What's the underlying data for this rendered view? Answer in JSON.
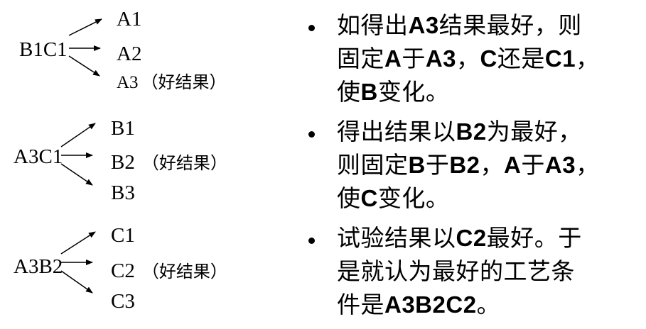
{
  "left": {
    "groups": [
      {
        "source": "B1C1",
        "targets": [
          {
            "label": "A1",
            "note": ""
          },
          {
            "label": "A2",
            "note": ""
          },
          {
            "label": "A3",
            "note": "（好结果）"
          }
        ]
      },
      {
        "source": "A3C1",
        "targets": [
          {
            "label": "B1",
            "note": ""
          },
          {
            "label": "B2",
            "note": "（好结果）"
          },
          {
            "label": "B3",
            "note": ""
          }
        ]
      },
      {
        "source": "A3B2",
        "targets": [
          {
            "label": "C1",
            "note": ""
          },
          {
            "label": "C2",
            "note": "（好结果）"
          },
          {
            "label": "C3",
            "note": ""
          }
        ]
      }
    ]
  },
  "right": {
    "bullets": [
      {
        "lines": [
          [
            {
              "t": "如得出",
              "b": false
            },
            {
              "t": "A3",
              "b": true
            },
            {
              "t": "结果最好，则",
              "b": false
            }
          ],
          [
            {
              "t": "固定",
              "b": false
            },
            {
              "t": "A",
              "b": true
            },
            {
              "t": "于",
              "b": false
            },
            {
              "t": "A3",
              "b": true
            },
            {
              "t": "，",
              "b": false
            },
            {
              "t": "C",
              "b": true
            },
            {
              "t": "还是",
              "b": false
            },
            {
              "t": "C1",
              "b": true
            },
            {
              "t": "，",
              "b": false
            }
          ],
          [
            {
              "t": "使",
              "b": false
            },
            {
              "t": "B",
              "b": true
            },
            {
              "t": "变化。",
              "b": false
            }
          ]
        ]
      },
      {
        "lines": [
          [
            {
              "t": "得出结果以",
              "b": false
            },
            {
              "t": "B2",
              "b": true
            },
            {
              "t": "为最好，",
              "b": false
            }
          ],
          [
            {
              "t": "则固定",
              "b": false
            },
            {
              "t": "B",
              "b": true
            },
            {
              "t": "于",
              "b": false
            },
            {
              "t": "B2",
              "b": true
            },
            {
              "t": "，",
              "b": false
            },
            {
              "t": "A",
              "b": true
            },
            {
              "t": "于",
              "b": false
            },
            {
              "t": "A3",
              "b": true
            },
            {
              "t": "，",
              "b": false
            }
          ],
          [
            {
              "t": "使",
              "b": false
            },
            {
              "t": "C",
              "b": true
            },
            {
              "t": "变化。",
              "b": false
            }
          ]
        ]
      },
      {
        "lines": [
          [
            {
              "t": "试验结果以",
              "b": false
            },
            {
              "t": "C2",
              "b": true
            },
            {
              "t": "最好。于",
              "b": false
            }
          ],
          [
            {
              "t": "是就认为最好的工艺条",
              "b": false
            }
          ],
          [
            {
              "t": "件是",
              "b": false
            },
            {
              "t": "A3B2C2",
              "b": true
            },
            {
              "t": "。",
              "b": false
            }
          ]
        ]
      }
    ]
  }
}
